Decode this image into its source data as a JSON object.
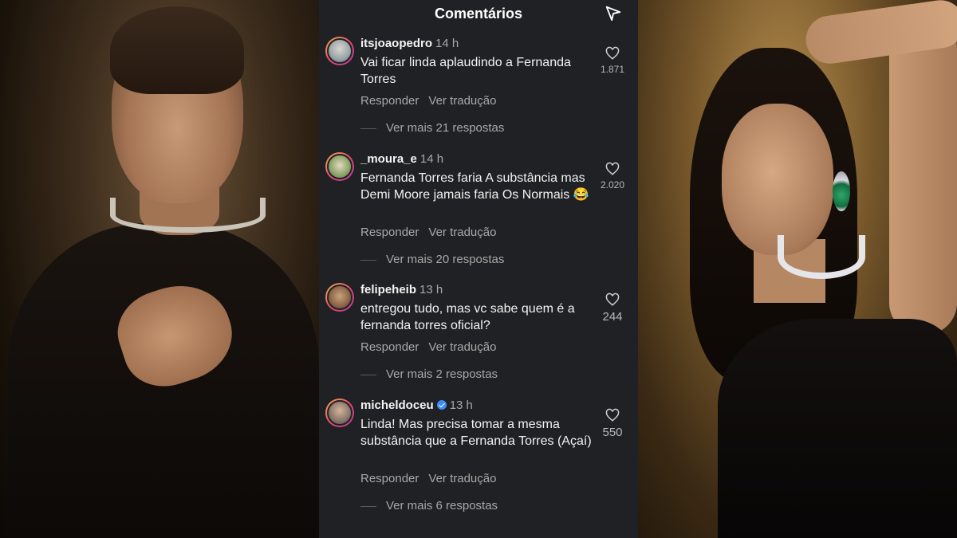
{
  "header": {
    "title": "Comentários",
    "send_icon": "paper-plane-icon"
  },
  "comments": [
    {
      "username": "itsjoaopedro",
      "time": "14 h",
      "text": "Vai ficar linda aplaudindo a Fernanda Torres",
      "reply": "Responder",
      "translate": "Ver tradução",
      "more_replies": "Ver mais 21 respostas",
      "likes": "1.871",
      "verified": false
    },
    {
      "username": "_moura_e",
      "time": "14 h",
      "text": "Fernanda Torres faria A substância mas Demi Moore jamais faria Os Normais 😂",
      "reply": "Responder",
      "translate": "Ver tradução",
      "more_replies": "Ver mais 20 respostas",
      "likes": "2.020",
      "verified": false
    },
    {
      "username": "felipeheib",
      "time": "13 h",
      "text": "entregou tudo, mas vc sabe quem é a fernanda torres oficial?",
      "reply": "Responder",
      "translate": "Ver tradução",
      "more_replies": "Ver mais 2 respostas",
      "likes": "244",
      "verified": false
    },
    {
      "username": "micheldoceu",
      "time": "13 h",
      "text": "Linda! Mas precisa tomar a mesma substância que a Fernanda Torres (Açaí)",
      "reply": "Responder",
      "translate": "Ver tradução",
      "more_replies": "Ver mais 6 respostas",
      "likes": "550",
      "verified": true
    }
  ],
  "colors": {
    "panel_bg": "#202124",
    "muted_text": "#a8a8a8",
    "verified_blue": "#3d8bf5"
  }
}
